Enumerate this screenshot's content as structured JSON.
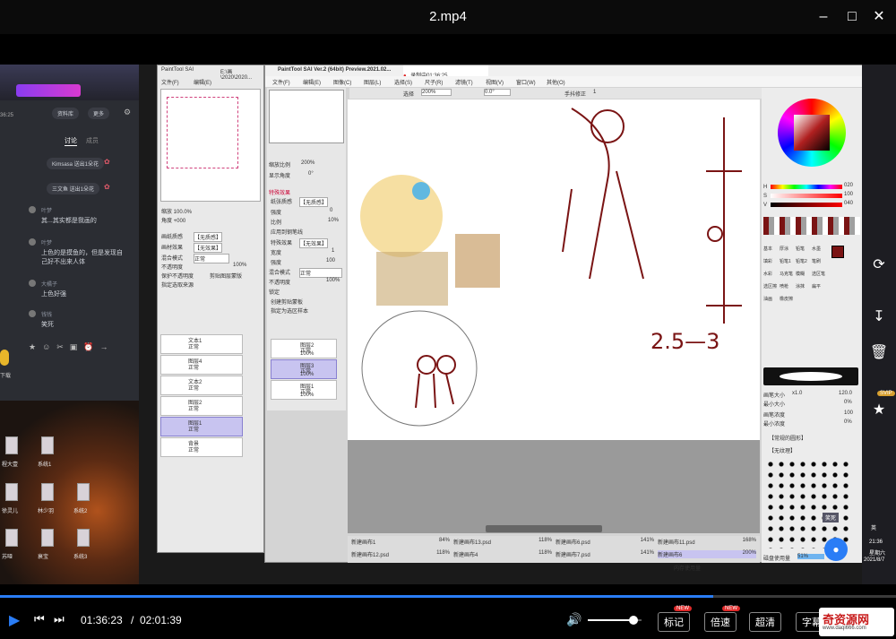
{
  "window": {
    "title": "2.mp4"
  },
  "chat": {
    "tabs": [
      "讨论",
      "成员"
    ],
    "top_buttons": [
      "资料库",
      "更多"
    ],
    "time": "36:25",
    "system_msgs": [
      "Kimsasa 送出1朵花",
      "三文鱼 送出1朵花"
    ],
    "messages": [
      {
        "name": "叶梦",
        "text": "其...其实都是我画的"
      },
      {
        "name": "叶梦",
        "text": "上色的是摸鱼的，但是发现自己好不出来人体"
      },
      {
        "name": "大橘子",
        "text": "上色好强"
      },
      {
        "name": "钱钱",
        "text": "笑死"
      }
    ],
    "avatars": [
      "程大壹",
      "系统1",
      "徐灵儿",
      "林少羽",
      "系统2",
      "苏哑",
      "衰宝",
      "系统3"
    ],
    "left_cut": "下载"
  },
  "sai_left": {
    "title": "PaintTool SAI",
    "path": "E:\\画\\2020\\2020...",
    "menus": [
      "文件(F)",
      "编辑(E)"
    ],
    "zoom": "100.0%",
    "angle": "+000",
    "layers": [
      {
        "name": "文本1",
        "mode": "正常",
        "opacity": "100%"
      },
      {
        "name": "图层4",
        "mode": "正常",
        "opacity": "100%"
      },
      {
        "name": "文本2",
        "mode": "正常",
        "opacity": "100%"
      },
      {
        "name": "图层2",
        "mode": "正常",
        "opacity": "100%"
      },
      {
        "name": "图层1",
        "mode": "正常",
        "opacity": "100%"
      },
      {
        "name": "背景",
        "mode": "正常",
        "opacity": "100%"
      }
    ],
    "props": [
      "画纸质感",
      "【无质感】",
      "画材效果",
      "【无效果】",
      "混合模式",
      "正常",
      "不透明度",
      "100%"
    ],
    "checks": [
      "保护不透明度",
      "剪贴图层蒙版",
      "指定选取来源"
    ]
  },
  "sai_main": {
    "title": "PaintTool SAI Ver.2 (64bit) Preview.2021.02...",
    "recording": "录制中01:36:25",
    "menus": [
      "文件(F)",
      "编辑(E)",
      "图像(C)",
      "图层(L)",
      "选择(S)",
      "尺子(R)",
      "滤镜(T)",
      "视图(V)",
      "窗口(W)",
      "其他(O)"
    ],
    "toolbar": {
      "select": "选择",
      "zoom": "200%",
      "angle": "0.0°",
      "stabilizer_label": "手抖修正",
      "stabilizer_value": "1"
    },
    "nav": {
      "zoom_label": "缩放比例",
      "zoom": "200%",
      "angle_label": "显示角度",
      "angle": "0°"
    },
    "effects": {
      "header": "特殊效果",
      "paper": "纸张质感",
      "paper_val": "【无质感】",
      "strength": "强度",
      "strength_val": "0",
      "ratio": "比例",
      "ratio_val": "10%",
      "apply": "应用到钢笔线",
      "fx": "特殊效果",
      "fx_val": "【无效果】",
      "width": "宽度",
      "width_val": "1",
      "fx_strength": "强度",
      "fx_strength_val": "100",
      "blend": "混合模式",
      "blend_val": "正常",
      "opacity": "不透明度",
      "opacity_val": "100%",
      "lock": "锁定",
      "clip": "创建剪贴蒙板",
      "source": "指定为选区样本"
    },
    "layers": [
      {
        "name": "图层2",
        "mode": "正常",
        "opacity": "100%"
      },
      {
        "name": "图层3",
        "mode": "正常",
        "opacity": "100%"
      },
      {
        "name": "图层1",
        "mode": "正常",
        "opacity": "100%"
      }
    ],
    "canvas_text": "2.5—3",
    "files": [
      {
        "name": "新建画布1",
        "zoom": "84%"
      },
      {
        "name": "新建画布13.psd",
        "zoom": "118%"
      },
      {
        "name": "新建画布6.psd",
        "zoom": "141%"
      },
      {
        "name": "新建画布11.psd",
        "zoom": "168%"
      },
      {
        "name": "新建画布12.psd",
        "zoom": "118%"
      },
      {
        "name": "新建画布4",
        "zoom": "118%"
      },
      {
        "name": "新建画布7.psd",
        "zoom": "141%"
      },
      {
        "name": "新建画布6",
        "zoom": "200%"
      }
    ],
    "memory_label": "内存使用量",
    "memory_val": "(8%)",
    "disk_label": "磁盘使用量",
    "disk_val": "51%",
    "color": {
      "h": "H",
      "s": "S",
      "v": "V",
      "h_val": "020",
      "s_val": "100",
      "v_val": "040"
    },
    "tools": [
      "基本",
      "厚涂",
      "铅笔",
      "水墨",
      "填彩",
      "铅笔1",
      "铅笔2",
      "笔刷",
      "水彩",
      "马克笔",
      "模糊",
      "选区笔",
      "选区擦",
      "喷枪",
      "涂抹",
      "扁平",
      "油画",
      "橡皮擦"
    ],
    "brush": {
      "size_label": "画笔大小",
      "size_mult": "x1.0",
      "size_val": "120.0",
      "min_label": "最小大小",
      "min_val": "0%",
      "density_label": "画笔浓度",
      "density_val": "100",
      "min_density_label": "最小浓度",
      "min_density_val": "0%",
      "shape": "【常规的圆形】",
      "texture": "【无纹理】"
    }
  },
  "side": {
    "clock": "21:36",
    "weekday": "星期六",
    "date": "2021/8/7",
    "lang": "英",
    "vip": "SVIP",
    "laugh": "笑死"
  },
  "controls": {
    "current_time": "01:36:23",
    "separator": "/",
    "total_time": "02:01:39",
    "progress": 0.796,
    "volume": 0.85,
    "buttons": [
      "标记",
      "倍速",
      "超清",
      "字幕"
    ],
    "new_badge": "NEW",
    "watermark": "奇资源网",
    "watermark_url": "www.daqi666.com"
  },
  "colors": {
    "accent": "#2a7df6",
    "selected_layer": "#c8c4f0",
    "ink": "#7a1414"
  }
}
